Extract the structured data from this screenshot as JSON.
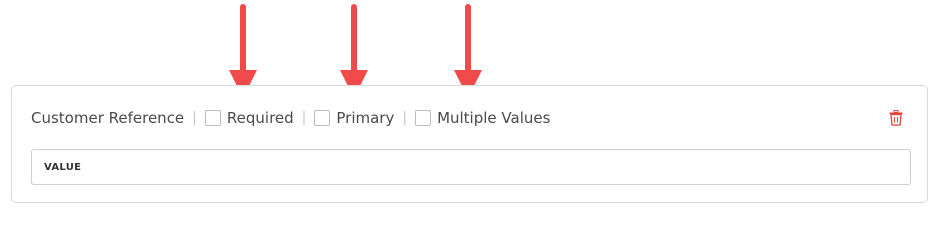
{
  "field": {
    "label": "Customer Reference",
    "separator": "|",
    "options": [
      {
        "label": "Required",
        "checked": false
      },
      {
        "label": "Primary",
        "checked": false
      },
      {
        "label": "Multiple Values",
        "checked": false
      }
    ],
    "value_placeholder": "VALUE",
    "delete_icon": "trash-icon"
  },
  "annotations": {
    "arrow_color": "#f04a4a",
    "arrow_icon": "arrow-down-icon"
  },
  "colors": {
    "delete": "#e0443c",
    "border": "#d9d9d9"
  }
}
